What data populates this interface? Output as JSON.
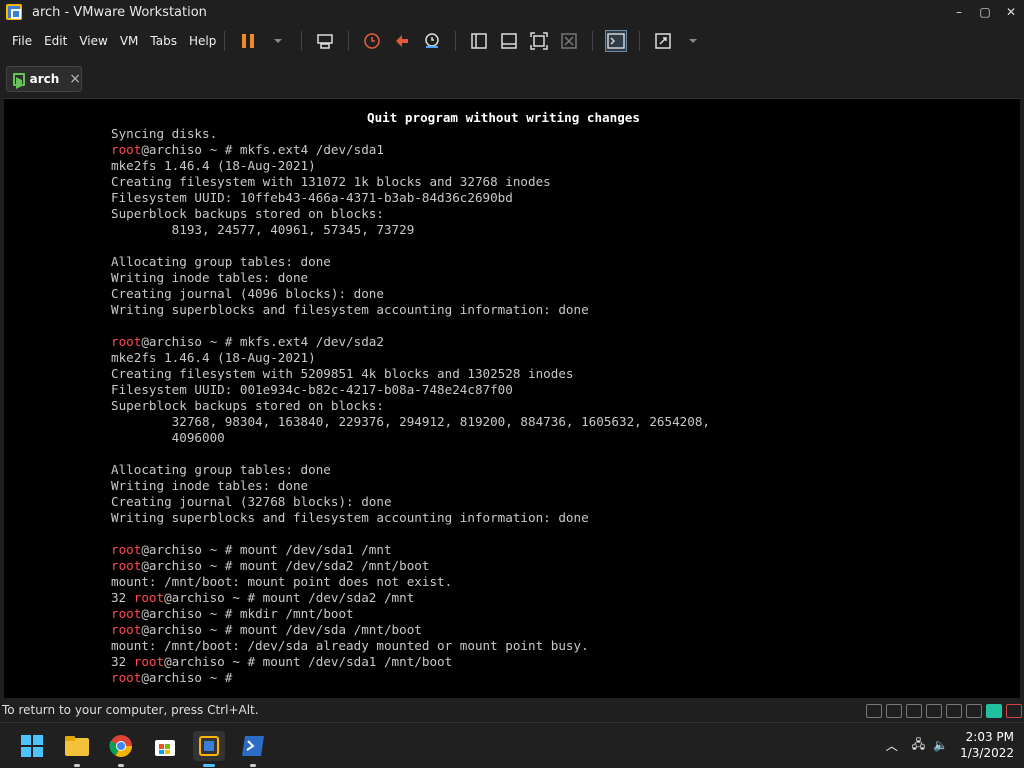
{
  "window": {
    "title": "arch - VMware Workstation"
  },
  "menu": {
    "items": [
      "File",
      "Edit",
      "View",
      "VM",
      "Tabs",
      "Help"
    ]
  },
  "tabs": [
    {
      "label": "arch",
      "close": "×"
    }
  ],
  "console": {
    "title": "Quit program without writing changes",
    "lines": [
      "Syncing disks.",
      "root@archiso ~ # mkfs.ext4 /dev/sda1",
      "mke2fs 1.46.4 (18-Aug-2021)",
      "Creating filesystem with 131072 1k blocks and 32768 inodes",
      "Filesystem UUID: 10ffeb43-466a-4371-b3ab-84d36c2690bd",
      "Superblock backups stored on blocks:",
      "        8193, 24577, 40961, 57345, 73729",
      "",
      "Allocating group tables: done",
      "Writing inode tables: done",
      "Creating journal (4096 blocks): done",
      "Writing superblocks and filesystem accounting information: done",
      "",
      "root@archiso ~ # mkfs.ext4 /dev/sda2",
      "mke2fs 1.46.4 (18-Aug-2021)",
      "Creating filesystem with 5209851 4k blocks and 1302528 inodes",
      "Filesystem UUID: 001e934c-b82c-4217-b08a-748e24c87f00",
      "Superblock backups stored on blocks:",
      "        32768, 98304, 163840, 229376, 294912, 819200, 884736, 1605632, 2654208,",
      "        4096000",
      "",
      "Allocating group tables: done",
      "Writing inode tables: done",
      "Creating journal (32768 blocks): done",
      "Writing superblocks and filesystem accounting information: done",
      "",
      "root@archiso ~ # mount /dev/sda1 /mnt",
      "root@archiso ~ # mount /dev/sda2 /mnt/boot",
      "mount: /mnt/boot: mount point does not exist.",
      "32 root@archiso ~ # mount /dev/sda2 /mnt",
      "root@archiso ~ # mkdir /mnt/boot",
      "root@archiso ~ # mount /dev/sda /mnt/boot",
      "mount: /mnt/boot: /dev/sda already mounted or mount point busy.",
      "32 root@archiso ~ # mount /dev/sda1 /mnt/boot",
      "root@archiso ~ #"
    ]
  },
  "status": {
    "text": "To return to your computer, press Ctrl+Alt."
  },
  "taskbar": {
    "time": "2:03 PM",
    "date": "1/3/2022"
  },
  "colors": {
    "prompt_root": "#ff4b4b",
    "console_bg": "#000000",
    "chrome_bg": "#1f1f1f"
  }
}
